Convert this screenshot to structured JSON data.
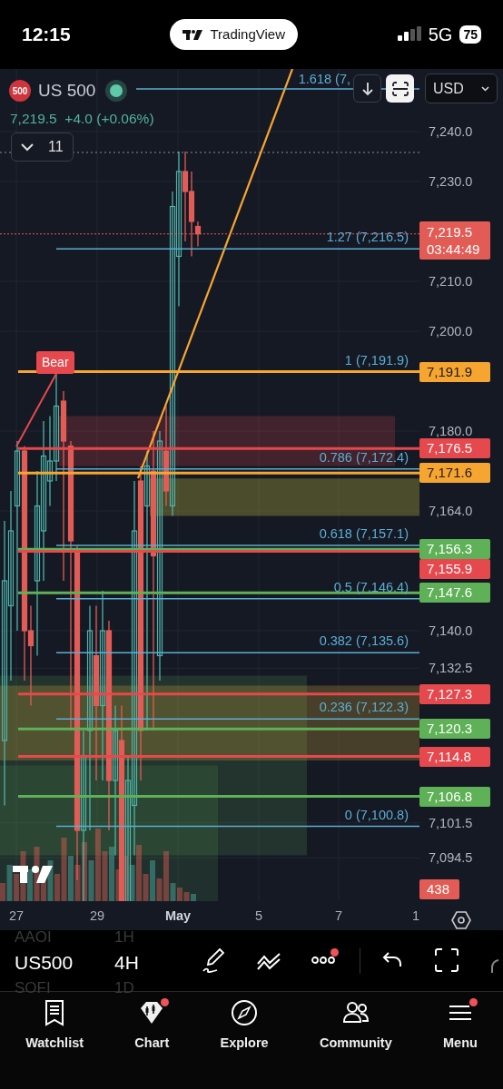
{
  "status_bar": {
    "time": "12:15",
    "app_pill": "TradingView",
    "network": "5G",
    "battery": "75"
  },
  "chart": {
    "symbol_badge": "500",
    "symbol": "US 500",
    "price": "7,219.5",
    "change": "+4.0 (+0.06%)",
    "indicators_count": "11",
    "currency": "USD",
    "top_fib_label": "1.618 (7,",
    "pattern_label": "Bear",
    "y_axis": [
      "7,240.0",
      "7,230.0",
      "7,210.0",
      "7,200.0",
      "7,180.0",
      "7,164.0",
      "7,140.0",
      "7,132.5",
      "7,101.5",
      "7,094.5"
    ],
    "fib_levels": [
      "1.27 (7,216.5)",
      "1 (7,191.9)",
      "0.786 (7,172.4)",
      "0.618 (7,157.1)",
      "0.5 (7,146.4)",
      "0.382 (7,135.6)",
      "0.236 (7,122.3)",
      "0 (7,100.8)"
    ],
    "last_price_tag": {
      "price": "7,219.5",
      "countdown": "03:44:49",
      "color": "#e25c55"
    },
    "price_tags": [
      {
        "label": "7,191.9",
        "color": "#f7a531"
      },
      {
        "label": "7,176.5",
        "color": "#e5484d"
      },
      {
        "label": "7,171.6",
        "color": "#f7a531"
      },
      {
        "label": "7,156.3",
        "color": "#5fb157"
      },
      {
        "label": "7,155.9",
        "color": "#e5484d"
      },
      {
        "label": "7,147.6",
        "color": "#5fb157"
      },
      {
        "label": "7,127.3",
        "color": "#e5484d"
      },
      {
        "label": "7,120.3",
        "color": "#5fb157"
      },
      {
        "label": "7,114.8",
        "color": "#e5484d"
      },
      {
        "label": "7,106.8",
        "color": "#5fb157"
      }
    ],
    "volume_tag": {
      "label": "438",
      "color": "#e25c55"
    },
    "x_axis": [
      {
        "label": "27",
        "emphasis": false
      },
      {
        "label": "29",
        "emphasis": false
      },
      {
        "label": "May",
        "emphasis": true
      },
      {
        "label": "5",
        "emphasis": false
      },
      {
        "label": "7",
        "emphasis": false
      },
      {
        "label": "1",
        "emphasis": false
      }
    ]
  },
  "toolbar": {
    "symbols": [
      {
        "label": "AAOI",
        "selected": false
      },
      {
        "label": "US500",
        "selected": true
      },
      {
        "label": "SOFI",
        "selected": false
      }
    ],
    "intervals": [
      {
        "label": "1H",
        "selected": false
      },
      {
        "label": "4H",
        "selected": true
      },
      {
        "label": "1D",
        "selected": false
      }
    ],
    "tools": [
      {
        "kind": "draw",
        "badge": false
      },
      {
        "kind": "patterns",
        "badge": false
      },
      {
        "kind": "more",
        "badge": true
      },
      {
        "kind": "undo",
        "badge": false
      },
      {
        "kind": "fullscreen",
        "badge": false
      }
    ]
  },
  "nav": [
    {
      "label": "Watchlist",
      "kind": "watchlist",
      "badge": false
    },
    {
      "label": "Chart",
      "kind": "chart",
      "badge": true
    },
    {
      "label": "Explore",
      "kind": "explore",
      "badge": false
    },
    {
      "label": "Community",
      "kind": "community",
      "badge": false
    },
    {
      "label": "Menu",
      "kind": "menu",
      "badge": true
    }
  ]
}
